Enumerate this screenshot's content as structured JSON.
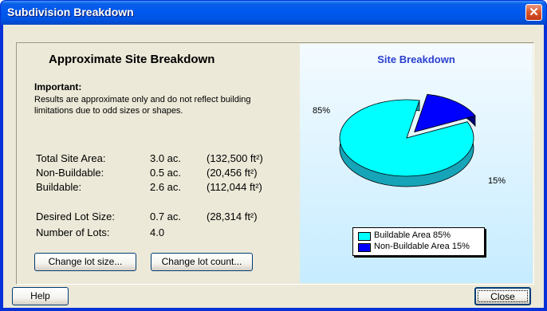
{
  "window": {
    "title": "Subdivision Breakdown",
    "close_glyph": "✕"
  },
  "summary": {
    "heading": "Approximate Site Breakdown",
    "important_label": "Important:",
    "important_text": "Results are approximate only and do not reflect building limitations due to odd sizes or shapes.",
    "rows": [
      {
        "label": "Total Site Area:",
        "acres": "3.0 ac.",
        "sqft": "(132,500 ft²)"
      },
      {
        "label": "Non-Buildable:",
        "acres": "0.5 ac.",
        "sqft": "(20,456 ft²)"
      },
      {
        "label": "Buildable:",
        "acres": "2.6 ac.",
        "sqft": "(112,044 ft²)"
      },
      {
        "label": "Desired Lot Size:",
        "acres": "0.7 ac.",
        "sqft": "(28,314 ft²)"
      },
      {
        "label": "Number of Lots:",
        "acres": "4.0",
        "sqft": ""
      }
    ],
    "buttons": {
      "change_lot_size": "Change lot size...",
      "change_lot_count": "Change lot count..."
    }
  },
  "chart_data": {
    "type": "pie",
    "title": "Site Breakdown",
    "categories": [
      "Buildable Area",
      "Non-Buildable Area"
    ],
    "values": [
      85,
      15
    ],
    "data_labels": [
      "85%",
      "15%"
    ],
    "legend": [
      "Buildable Area 85%",
      "Non-Buildable Area 15%"
    ],
    "legend_position": "bottom",
    "colors": [
      "#00ffff",
      "#0000ff"
    ]
  },
  "footer": {
    "help_label": "Help",
    "close_label": "Close"
  },
  "colors": {
    "titlebar": "#0055e5",
    "dialog_bg": "#ece9d8",
    "chart_title": "#2a3fd0"
  }
}
